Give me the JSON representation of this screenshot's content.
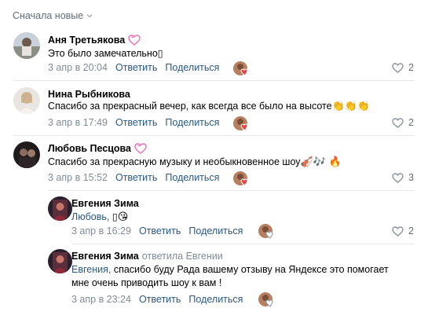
{
  "sort": {
    "label": "Сначала новые"
  },
  "comments": [
    {
      "author": "Аня Третьякова",
      "text": "Это было замечательно",
      "time": "3 апр в 20:04",
      "reply": "Ответить",
      "share": "Поделиться",
      "likes": "2"
    },
    {
      "author": "Нина Рыбникова",
      "text": "Спасибо за прекрасный вечер, как всегда все было на высоте",
      "time": "3 апр в 17:49",
      "reply": "Ответить",
      "share": "Поделиться",
      "likes": "2"
    },
    {
      "author": "Любовь Песцова",
      "text": "Спасибо за прекрасную музыку и необыкновенное шоу",
      "time": "3 апр в 15:52",
      "reply": "Ответить",
      "share": "Поделиться",
      "likes": "3"
    }
  ],
  "replies": [
    {
      "author": "Евгения Зима",
      "addressee": "Любовь,",
      "time": "3 апр в 16:29",
      "reply": "Ответить",
      "share": "Поделиться",
      "likes": "2"
    },
    {
      "author": "Евгения Зима",
      "replied_to": "ответила Евгении",
      "addressee": "Евгения,",
      "text_line1": "спасибо буду Рада вашему отзыву на Яндексе это помогает",
      "text_line2": "мне очень приводить шоу к вам !",
      "time": "3 апр в 23:24",
      "reply": "Ответить",
      "share": "Поделиться"
    }
  ],
  "colors": {
    "link": "#2a5885",
    "meta": "#818c99",
    "badge": "#f06ab8",
    "heart": "#e64646"
  },
  "icons": {
    "sort_chevron": "chevron-down-icon",
    "like": "heart-outline-icon",
    "badge": "heart-badge-icon"
  }
}
